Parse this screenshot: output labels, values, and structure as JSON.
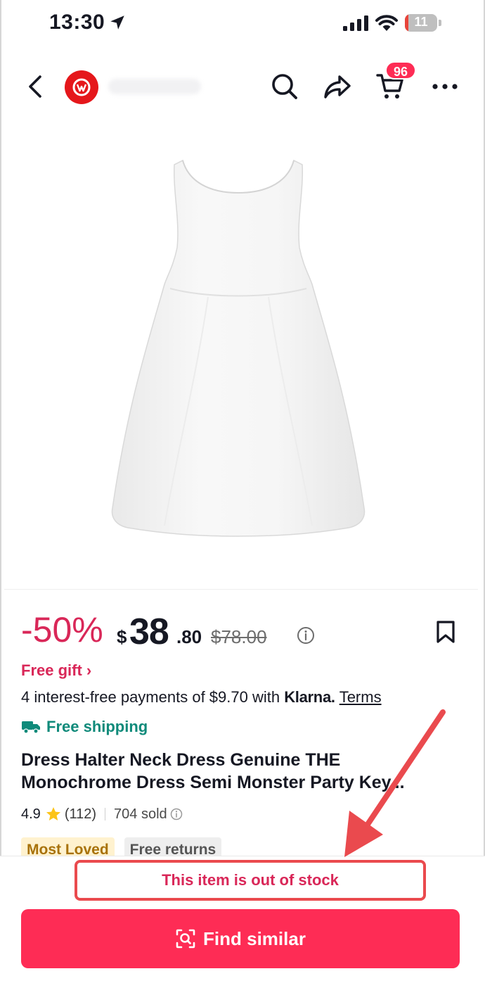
{
  "status_bar": {
    "time": "13:30",
    "battery_level": "11",
    "battery_fraction": 0.11
  },
  "nav": {
    "cart_count": "96",
    "icons": [
      "back-icon",
      "search-icon",
      "share-icon",
      "cart-icon",
      "more-icon"
    ]
  },
  "product": {
    "discount": "-50%",
    "currency": "$",
    "price_whole": "38",
    "price_cents": ".80",
    "original_price": "$78.00",
    "free_gift": "Free gift ›",
    "payments": {
      "prefix": "4 interest-free payments of $9.70 with ",
      "provider": "Klarna.",
      "terms": "Terms"
    },
    "shipping": "Free shipping",
    "title_line_1": "Dress Halter Neck Dress Genuine THE",
    "title_line_2": "Monochrome Dress Semi Monster Party Key...",
    "rating": "4.9",
    "reviews": "(112)",
    "sold": "704 sold",
    "tags": [
      "Most Loved",
      "Free returns"
    ]
  },
  "bottom": {
    "stock_notice": "This item is out of stock",
    "action_label": "Find similar"
  },
  "colors": {
    "accent": "#fe2c55",
    "discount": "#d92758",
    "shipping": "#0f8a7a",
    "annotation": "#ea4a4e"
  }
}
